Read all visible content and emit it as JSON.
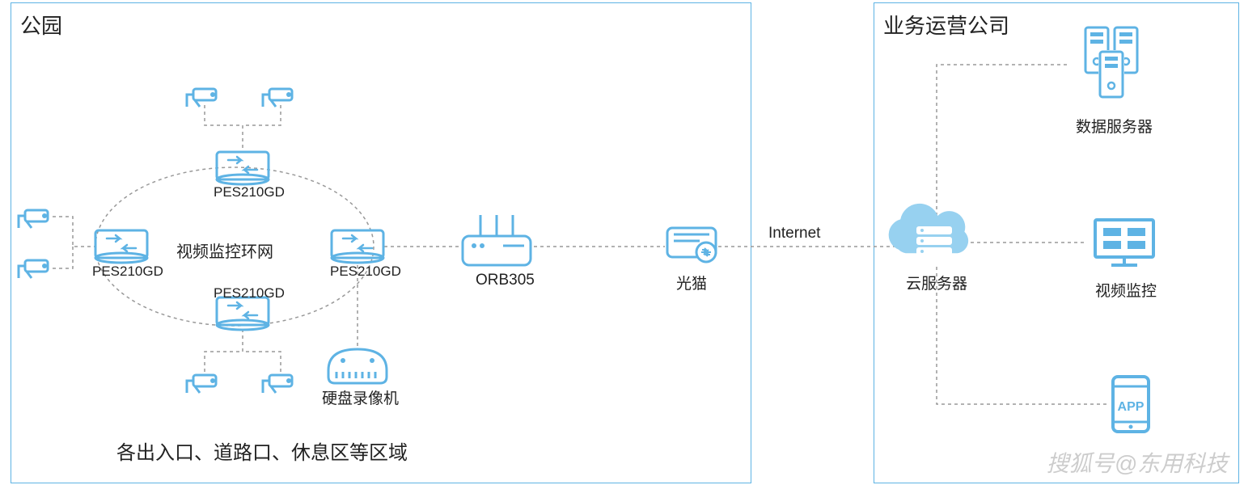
{
  "colors": {
    "accent": "#5eb3e4",
    "text": "#222222"
  },
  "park": {
    "title": "公园",
    "ring_label": "视频监控环网",
    "switch_label": "PES210GD",
    "nvr_label": "硬盘录像机",
    "footer": "各出入口、道路口、休息区等区域"
  },
  "router_label": "ORB305",
  "modem_label": "光猫",
  "internet_label": "Internet",
  "cloud_label": "云服务器",
  "company": {
    "title": "业务运营公司",
    "data_server": "数据服务器",
    "video_monitor": "视频监控",
    "app": "APP"
  },
  "watermark": "搜狐号@东用科技"
}
